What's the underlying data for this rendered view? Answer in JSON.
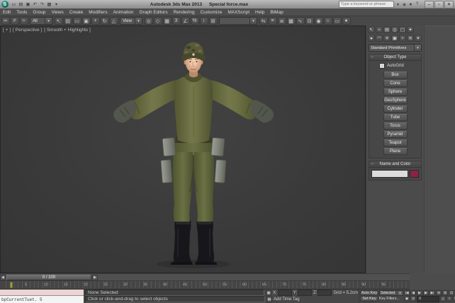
{
  "window": {
    "app_title": "Autodesk 3ds Max 2013",
    "doc_title": "Special force.max",
    "logo_glyph": "S",
    "qat_icons": [
      {
        "name": "new-scene-icon",
        "glyph": "▭"
      },
      {
        "name": "open-file-icon",
        "glyph": "▤"
      },
      {
        "name": "save-file-icon",
        "glyph": "▣"
      },
      {
        "name": "undo-icon",
        "glyph": "↶"
      },
      {
        "name": "redo-icon",
        "glyph": "↷"
      },
      {
        "name": "project-folder-icon",
        "glyph": "▦"
      },
      {
        "name": "qat-customize-icon",
        "glyph": "▾"
      }
    ],
    "search_placeholder": "Type a keyword or phrase",
    "infocenter_icons": [
      {
        "name": "search-icon",
        "glyph": "▾"
      },
      {
        "name": "communication-center-icon",
        "glyph": "◈"
      },
      {
        "name": "favorites-icon",
        "glyph": "★"
      },
      {
        "name": "help-icon",
        "glyph": "?"
      }
    ],
    "window_controls": [
      {
        "name": "minimize-button",
        "glyph": "–"
      },
      {
        "name": "restore-button",
        "glyph": "▫"
      },
      {
        "name": "close-button",
        "glyph": "✕"
      }
    ]
  },
  "menu": {
    "items": [
      "Edit",
      "Tools",
      "Group",
      "Views",
      "Create",
      "Modifiers",
      "Animation",
      "Graph Editors",
      "Rendering",
      "Customize",
      "MAXScript",
      "Help",
      "BiMap"
    ]
  },
  "toolbar": {
    "dropdown_arrow": "▾",
    "selection_filter": "All",
    "coordinate_system": "View",
    "named_selection": "",
    "group1": [
      {
        "name": "select-and-link-icon",
        "glyph": "∞"
      },
      {
        "name": "unlink-selection-icon",
        "glyph": "≠"
      },
      {
        "name": "bind-to-spacewarp-icon",
        "glyph": "≈"
      }
    ],
    "group2": [
      {
        "name": "select-object-icon",
        "glyph": "↖"
      },
      {
        "name": "select-by-name-icon",
        "glyph": "▤"
      },
      {
        "name": "rectangular-selection-region-icon",
        "glyph": "▭"
      },
      {
        "name": "window-crossing-icon",
        "glyph": "▣"
      },
      {
        "name": "select-and-move-icon",
        "glyph": "+"
      },
      {
        "name": "select-and-rotate-icon",
        "glyph": "↻"
      },
      {
        "name": "select-and-scale-icon",
        "glyph": "△"
      }
    ],
    "group3": [
      {
        "name": "use-pivot-point-center-icon",
        "glyph": "◎"
      },
      {
        "name": "select-and-manipulate-icon",
        "glyph": "◇"
      },
      {
        "name": "keyboard-override-toggle-icon",
        "glyph": "▦"
      },
      {
        "name": "snaps-toggle-icon",
        "glyph": "3"
      },
      {
        "name": "angle-snap-icon",
        "glyph": "∠"
      },
      {
        "name": "percent-snap-icon",
        "glyph": "%"
      },
      {
        "name": "spinner-snap-icon",
        "glyph": "↕"
      },
      {
        "name": "edit-named-selection-sets-icon",
        "glyph": "⊞"
      }
    ],
    "group4": [
      {
        "name": "mirror-icon",
        "glyph": "⇆"
      },
      {
        "name": "align-icon",
        "glyph": "≡"
      },
      {
        "name": "manage-layers-icon",
        "glyph": "≣"
      },
      {
        "name": "graphite-ribbon-icon",
        "glyph": "▩"
      },
      {
        "name": "curve-editor-icon",
        "glyph": "∿"
      },
      {
        "name": "schematic-view-icon",
        "glyph": "⊟"
      },
      {
        "name": "material-editor-icon",
        "glyph": "◉"
      },
      {
        "name": "render-setup-icon",
        "glyph": "☼"
      },
      {
        "name": "rendered-frame-window-icon",
        "glyph": "▭"
      },
      {
        "name": "render-production-icon",
        "glyph": "●"
      }
    ]
  },
  "viewport": {
    "label_plus": "[ + ]",
    "label_view": "[ Perspective ]",
    "label_shading": "[ Smooth + Highlights ]"
  },
  "command_panel": {
    "tabs": [
      {
        "name": "tab-create-icon",
        "glyph": "↖"
      },
      {
        "name": "tab-modify-icon",
        "glyph": "≈"
      },
      {
        "name": "tab-hierarchy-icon",
        "glyph": "▤"
      },
      {
        "name": "tab-motion-icon",
        "glyph": "◎"
      },
      {
        "name": "tab-display-icon",
        "glyph": "▢"
      },
      {
        "name": "tab-utilities-icon",
        "glyph": "✦"
      }
    ],
    "categories": [
      {
        "name": "category-geometry-icon",
        "glyph": "●"
      },
      {
        "name": "category-shapes-icon",
        "glyph": "◠"
      },
      {
        "name": "category-lights-icon",
        "glyph": "☀"
      },
      {
        "name": "category-cameras-icon",
        "glyph": "▣"
      },
      {
        "name": "category-helpers-icon",
        "glyph": "+"
      },
      {
        "name": "category-spacewarps-icon",
        "glyph": "≋"
      },
      {
        "name": "category-systems-icon",
        "glyph": "✶"
      }
    ],
    "primitives_dropdown": "Standard Primitives",
    "object_type": {
      "title": "Object Type",
      "autogrid_label": "AutoGrid",
      "buttons": [
        {
          "name": "box-button",
          "label": "Box"
        },
        {
          "name": "cone-button",
          "label": "Cone"
        },
        {
          "name": "sphere-button",
          "label": "Sphere"
        },
        {
          "name": "geosphere-button",
          "label": "GeoSphere"
        },
        {
          "name": "cylinder-button",
          "label": "Cylinder"
        },
        {
          "name": "tube-button",
          "label": "Tube"
        },
        {
          "name": "torus-button",
          "label": "Torus"
        },
        {
          "name": "pyramid-button",
          "label": "Pyramid"
        },
        {
          "name": "teapot-button",
          "label": "Teapot"
        },
        {
          "name": "plane-button",
          "label": "Plane"
        }
      ]
    },
    "name_and_color": {
      "title": "Name and Color",
      "name_value": "",
      "swatch_color": "#8b2246"
    }
  },
  "timeline": {
    "slider_label": "0 / 100",
    "prev_glyph": "◀",
    "next_glyph": "▶",
    "tick_labels": [
      "5",
      "10",
      "15",
      "20",
      "25",
      "30",
      "35",
      "40",
      "45",
      "50",
      "55",
      "60",
      "65",
      "70",
      "75",
      "80",
      "85",
      "90",
      "95"
    ]
  },
  "status": {
    "macro_recorder": "",
    "listener_line": "bpCurrentTuet. 5",
    "selection_status": "None Selected",
    "prompt": "Click or click-and-drag to select objects",
    "lock_glyph": "▣",
    "x_label": "X:",
    "y_label": "Y:",
    "z_label": "Z:",
    "x_value": "",
    "y_value": "",
    "z_value": "",
    "grid_label": "Grid = 5.2cm",
    "timetag_glyph": "▦",
    "add_time_tag": "Add Time Tag",
    "auto_key": "Auto Key",
    "set_key": "Set Key",
    "selected_filter": "Selected",
    "key_filters": "Key Filters...",
    "frame_value": "0",
    "playback_icons": [
      {
        "name": "go-to-start-button",
        "glyph": "|◀"
      },
      {
        "name": "previous-frame-button",
        "glyph": "◀"
      },
      {
        "name": "play-animation-button",
        "glyph": "▶"
      },
      {
        "name": "next-frame-button",
        "glyph": "▶"
      },
      {
        "name": "go-to-end-button",
        "glyph": "▶|"
      }
    ],
    "time_config_icons": [
      {
        "name": "key-mode-toggle-icon",
        "glyph": "◆"
      },
      {
        "name": "time-configuration-icon",
        "glyph": "◷"
      }
    ],
    "nav_icons_top": [
      {
        "name": "zoom-icon",
        "glyph": "⊕"
      },
      {
        "name": "zoom-all-icon",
        "glyph": "⊞"
      },
      {
        "name": "zoom-extents-icon",
        "glyph": "⊡"
      },
      {
        "name": "zoom-extents-all-icon",
        "glyph": "⊠"
      }
    ],
    "nav_icons_bottom": [
      {
        "name": "field-of-view-icon",
        "glyph": "△"
      },
      {
        "name": "pan-view-icon",
        "glyph": "+"
      },
      {
        "name": "orbit-icon",
        "glyph": "↻"
      },
      {
        "name": "maximize-viewport-toggle-icon",
        "glyph": "▣"
      }
    ]
  },
  "colors": {
    "object_color_swatch": "#8b2246",
    "viewport_background": "#3a3a3a",
    "ui_gray": "#4a4a4a",
    "uniform_olive": "#666a41",
    "trackbar_marker": "#a2a24e"
  }
}
